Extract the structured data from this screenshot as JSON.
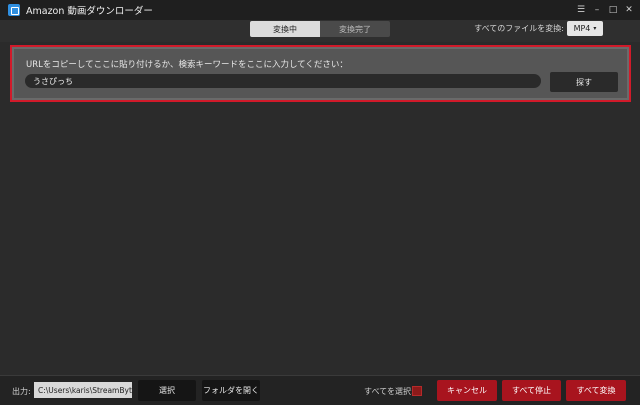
{
  "window": {
    "title": "Amazon 動画ダウンローダー",
    "controls": {
      "menu": "☰",
      "minimize": "–",
      "maximize": "□",
      "close": "✕"
    }
  },
  "toolbar": {
    "tabs": [
      {
        "label": "変換中",
        "active": true
      },
      {
        "label": "変換完了",
        "active": false
      }
    ],
    "convert_all_label": "すべてのファイルを変換:",
    "format": {
      "selected": "MP4",
      "caret": "▾"
    }
  },
  "url_panel": {
    "label": "URLをコピーしてここに貼り付けるか、検索キーワードをここに入力してください：",
    "input_value": "うさぴっち",
    "search_button": "探す"
  },
  "footer": {
    "output_label": "出力:",
    "output_path": "C:\\Users\\karis\\StreamByte",
    "select_button": "選択",
    "open_folder_button": "フォルダを開く",
    "select_all_label": "すべてを選択:",
    "cancel_button": "キャンセル",
    "stop_all_button": "すべて停止",
    "convert_all_button": "すべて変換"
  },
  "colors": {
    "accent_red": "#a8141e",
    "highlight_border": "#d11a2a",
    "app_icon": "#2f8fe0"
  },
  "icons": {
    "app": "app-icon",
    "menu": "menu-icon",
    "minimize": "minimize-icon",
    "maximize": "maximize-icon",
    "close": "close-icon",
    "dropdown": "chevron-down-icon",
    "checkbox": "checkbox-icon"
  }
}
